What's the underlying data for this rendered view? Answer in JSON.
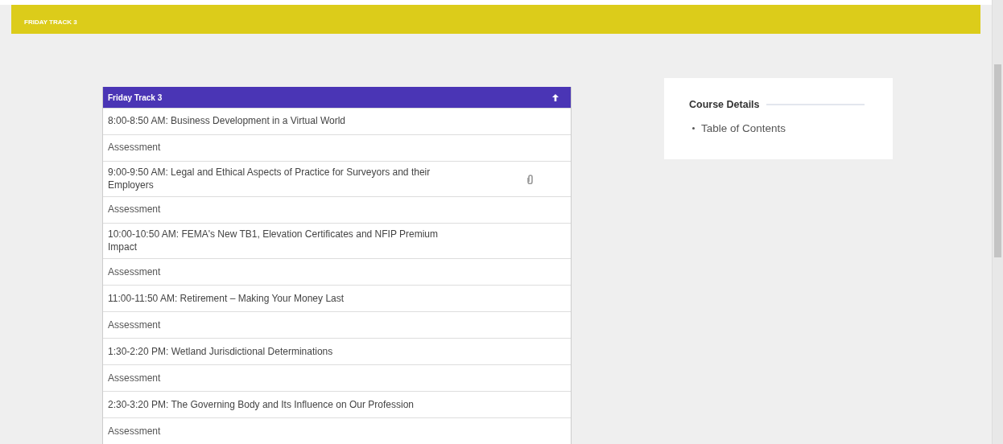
{
  "banner": {
    "title": "FRIDAY TRACK 3"
  },
  "track": {
    "title": "Friday Track 3",
    "expanded": true,
    "items": [
      {
        "kind": "lesson",
        "text": "8:00-8:50 AM: Business Development in a Virtual World",
        "attachment": false
      },
      {
        "kind": "assessment",
        "text": "Assessment",
        "attachment": false
      },
      {
        "kind": "lesson",
        "text": "9:00-9:50 AM: Legal and Ethical Aspects of Practice for Surveyors and their Employers",
        "attachment": true
      },
      {
        "kind": "assessment",
        "text": "Assessment",
        "attachment": false
      },
      {
        "kind": "lesson",
        "text": "10:00-10:50 AM: FEMA's New TB1, Elevation Certificates and NFIP Premium Impact",
        "attachment": false
      },
      {
        "kind": "assessment",
        "text": "Assessment",
        "attachment": false
      },
      {
        "kind": "lesson",
        "text": "11:00-11:50 AM: Retirement – Making Your Money Last",
        "attachment": false
      },
      {
        "kind": "assessment",
        "text": "Assessment",
        "attachment": false
      },
      {
        "kind": "lesson",
        "text": "1:30-2:20 PM: Wetland Jurisdictional Determinations",
        "attachment": false
      },
      {
        "kind": "assessment",
        "text": "Assessment",
        "attachment": false
      },
      {
        "kind": "lesson",
        "text": "2:30-3:20 PM: The Governing Body and Its Influence on Our Profession",
        "attachment": false
      },
      {
        "kind": "assessment",
        "text": "Assessment",
        "attachment": false
      }
    ]
  },
  "course_details": {
    "title": "Course Details",
    "links": [
      "Table of Contents"
    ]
  }
}
